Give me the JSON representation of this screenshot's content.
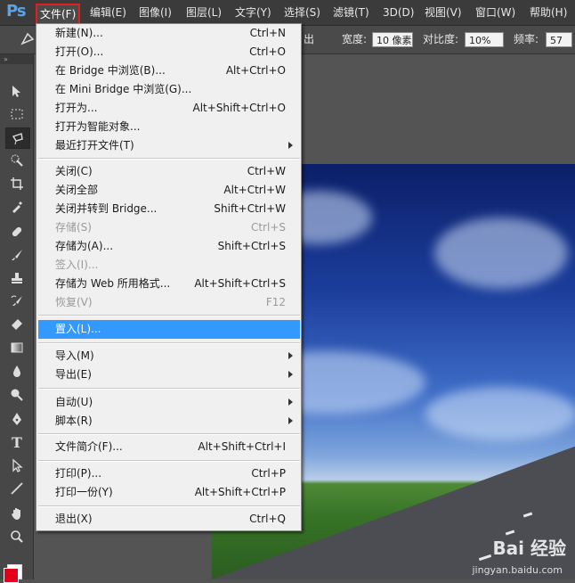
{
  "app": {
    "logo": "Ps"
  },
  "menubar": {
    "items": [
      "文件(F)",
      "编辑(E)",
      "图像(I)",
      "图层(L)",
      "文字(Y)",
      "选择(S)",
      "滤镜(T)",
      "3D(D)",
      "视图(V)",
      "窗口(W)",
      "帮助(H)"
    ]
  },
  "options_bar": {
    "partial_label": "出",
    "width_label": "宽度:",
    "width_value": "10 像素",
    "contrast_label": "对比度:",
    "contrast_value": "10%",
    "frequency_label": "频率:",
    "frequency_value": "57"
  },
  "file_menu": {
    "items": [
      {
        "label": "新建(N)...",
        "shortcut": "Ctrl+N"
      },
      {
        "label": "打开(O)...",
        "shortcut": "Ctrl+O"
      },
      {
        "label": "在 Bridge 中浏览(B)...",
        "shortcut": "Alt+Ctrl+O"
      },
      {
        "label": "在 Mini Bridge 中浏览(G)...",
        "shortcut": ""
      },
      {
        "label": "打开为...",
        "shortcut": "Alt+Shift+Ctrl+O"
      },
      {
        "label": "打开为智能对象...",
        "shortcut": ""
      },
      {
        "label": "最近打开文件(T)",
        "shortcut": ""
      },
      {
        "label": "关闭(C)",
        "shortcut": "Ctrl+W"
      },
      {
        "label": "关闭全部",
        "shortcut": "Alt+Ctrl+W"
      },
      {
        "label": "关闭并转到 Bridge...",
        "shortcut": "Shift+Ctrl+W"
      },
      {
        "label": "存储(S)",
        "shortcut": "Ctrl+S"
      },
      {
        "label": "存储为(A)...",
        "shortcut": "Shift+Ctrl+S"
      },
      {
        "label": "签入(I)...",
        "shortcut": ""
      },
      {
        "label": "存储为 Web 所用格式...",
        "shortcut": "Alt+Shift+Ctrl+S"
      },
      {
        "label": "恢复(V)",
        "shortcut": "F12"
      },
      {
        "label": "置入(L)...",
        "shortcut": ""
      },
      {
        "label": "导入(M)",
        "shortcut": ""
      },
      {
        "label": "导出(E)",
        "shortcut": ""
      },
      {
        "label": "自动(U)",
        "shortcut": ""
      },
      {
        "label": "脚本(R)",
        "shortcut": ""
      },
      {
        "label": "文件简介(F)...",
        "shortcut": "Alt+Shift+Ctrl+I"
      },
      {
        "label": "打印(P)...",
        "shortcut": "Ctrl+P"
      },
      {
        "label": "打印一份(Y)",
        "shortcut": "Alt+Shift+Ctrl+P"
      },
      {
        "label": "退出(X)",
        "shortcut": "Ctrl+Q"
      }
    ]
  },
  "toolbox": {
    "header": "»",
    "tools": [
      "move-tool-icon",
      "marquee-tool-icon",
      "lasso-tool-icon",
      "quick-selection-tool-icon",
      "crop-tool-icon",
      "eyedropper-tool-icon",
      "healing-brush-tool-icon",
      "brush-tool-icon",
      "clone-stamp-tool-icon",
      "history-brush-tool-icon",
      "eraser-tool-icon",
      "gradient-tool-icon",
      "blur-tool-icon",
      "dodge-tool-icon",
      "pen-tool-icon",
      "type-tool-icon",
      "path-selection-tool-icon",
      "line-tool-icon",
      "hand-tool-icon",
      "zoom-tool-icon"
    ],
    "foreground_color": "#e3001b",
    "background_color": "#ffffff"
  },
  "watermark": {
    "brand": "Bai 经验",
    "url": "jingyan.baidu.com"
  },
  "colors": {
    "menu_highlight": "#3399ff",
    "active_menu_border": "#e02020"
  }
}
